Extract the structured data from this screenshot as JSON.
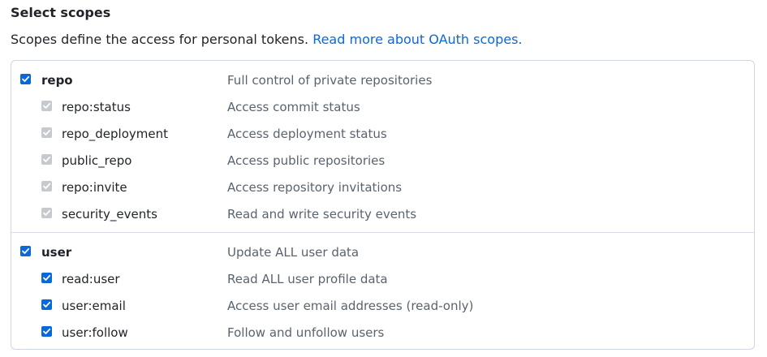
{
  "section": {
    "title": "Select scopes",
    "description": "Scopes define the access for personal tokens.",
    "link_text": "Read more about OAuth scopes."
  },
  "groups": [
    {
      "name": "repo",
      "description": "Full control of private repositories",
      "checked": true,
      "children": [
        {
          "name": "repo:status",
          "description": "Access commit status",
          "checked": true,
          "disabled": true
        },
        {
          "name": "repo_deployment",
          "description": "Access deployment status",
          "checked": true,
          "disabled": true
        },
        {
          "name": "public_repo",
          "description": "Access public repositories",
          "checked": true,
          "disabled": true
        },
        {
          "name": "repo:invite",
          "description": "Access repository invitations",
          "checked": true,
          "disabled": true
        },
        {
          "name": "security_events",
          "description": "Read and write security events",
          "checked": true,
          "disabled": true
        }
      ]
    },
    {
      "name": "user",
      "description": "Update ALL user data",
      "checked": true,
      "children": [
        {
          "name": "read:user",
          "description": "Read ALL user profile data",
          "checked": true,
          "disabled": false
        },
        {
          "name": "user:email",
          "description": "Access user email addresses (read-only)",
          "checked": true,
          "disabled": false
        },
        {
          "name": "user:follow",
          "description": "Follow and unfollow users",
          "checked": true,
          "disabled": false
        }
      ]
    }
  ],
  "colors": {
    "accent": "#0969da",
    "disabled_checkbox": "#c6cacf",
    "border": "#d0d7de",
    "muted_text": "#59636e"
  },
  "icons": {
    "checkmark": "check-icon"
  }
}
